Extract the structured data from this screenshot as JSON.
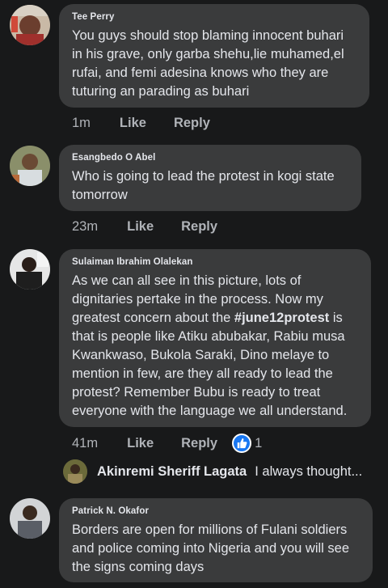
{
  "comments": [
    {
      "author": "Tee Perry",
      "lines": [
        "You guys should stop blaming innocent buhari",
        "in his grave, only garba shehu,lie muhamed,el",
        "rufai, and femi adesina knows who they are",
        "tuturing an parading as buhari"
      ],
      "time": "1m",
      "like": "Like",
      "reply": "Reply"
    },
    {
      "author": "Esangbedo O Abel",
      "lines": [
        "Who is going to lead the protest in kogi state",
        "tomorrow"
      ],
      "time": "23m",
      "like": "Like",
      "reply": "Reply"
    },
    {
      "author": "Sulaiman Ibrahim Olalekan",
      "line1": "As we can all see in this picture, lots of",
      "line2": "dignitaries pertake in the process.  Now my",
      "line3_pre": "greatest concern about the ",
      "line3_tag": "#june12protest",
      "line3_post": " is",
      "line4": "that is people like Atiku abubakar,  Rabiu musa",
      "line5": "Kwankwaso, Bukola Saraki, Dino melaye to",
      "line6": "mention in few, are they all ready to lead the",
      "line7": "protest?  Remember Bubu is ready to treat",
      "line8": "everyone with the language we all understand.",
      "time": "41m",
      "like": "Like",
      "reply": "Reply",
      "reaction_count": "1"
    },
    {
      "author": "Patrick N. Okafor",
      "lines": [
        "Borders are open for millions of Fulani soldiers",
        "and police coming into Nigeria and you will see",
        "the signs coming days"
      ]
    }
  ],
  "reply_preview": {
    "name": "Akinremi Sheriff Lagata",
    "text": "I always thought..."
  },
  "colors": {
    "background": "#18191a",
    "bubble": "#3a3b3c",
    "text": "#e4e6eb",
    "muted": "#b0b3b8",
    "like_blue": "#1877f2"
  }
}
